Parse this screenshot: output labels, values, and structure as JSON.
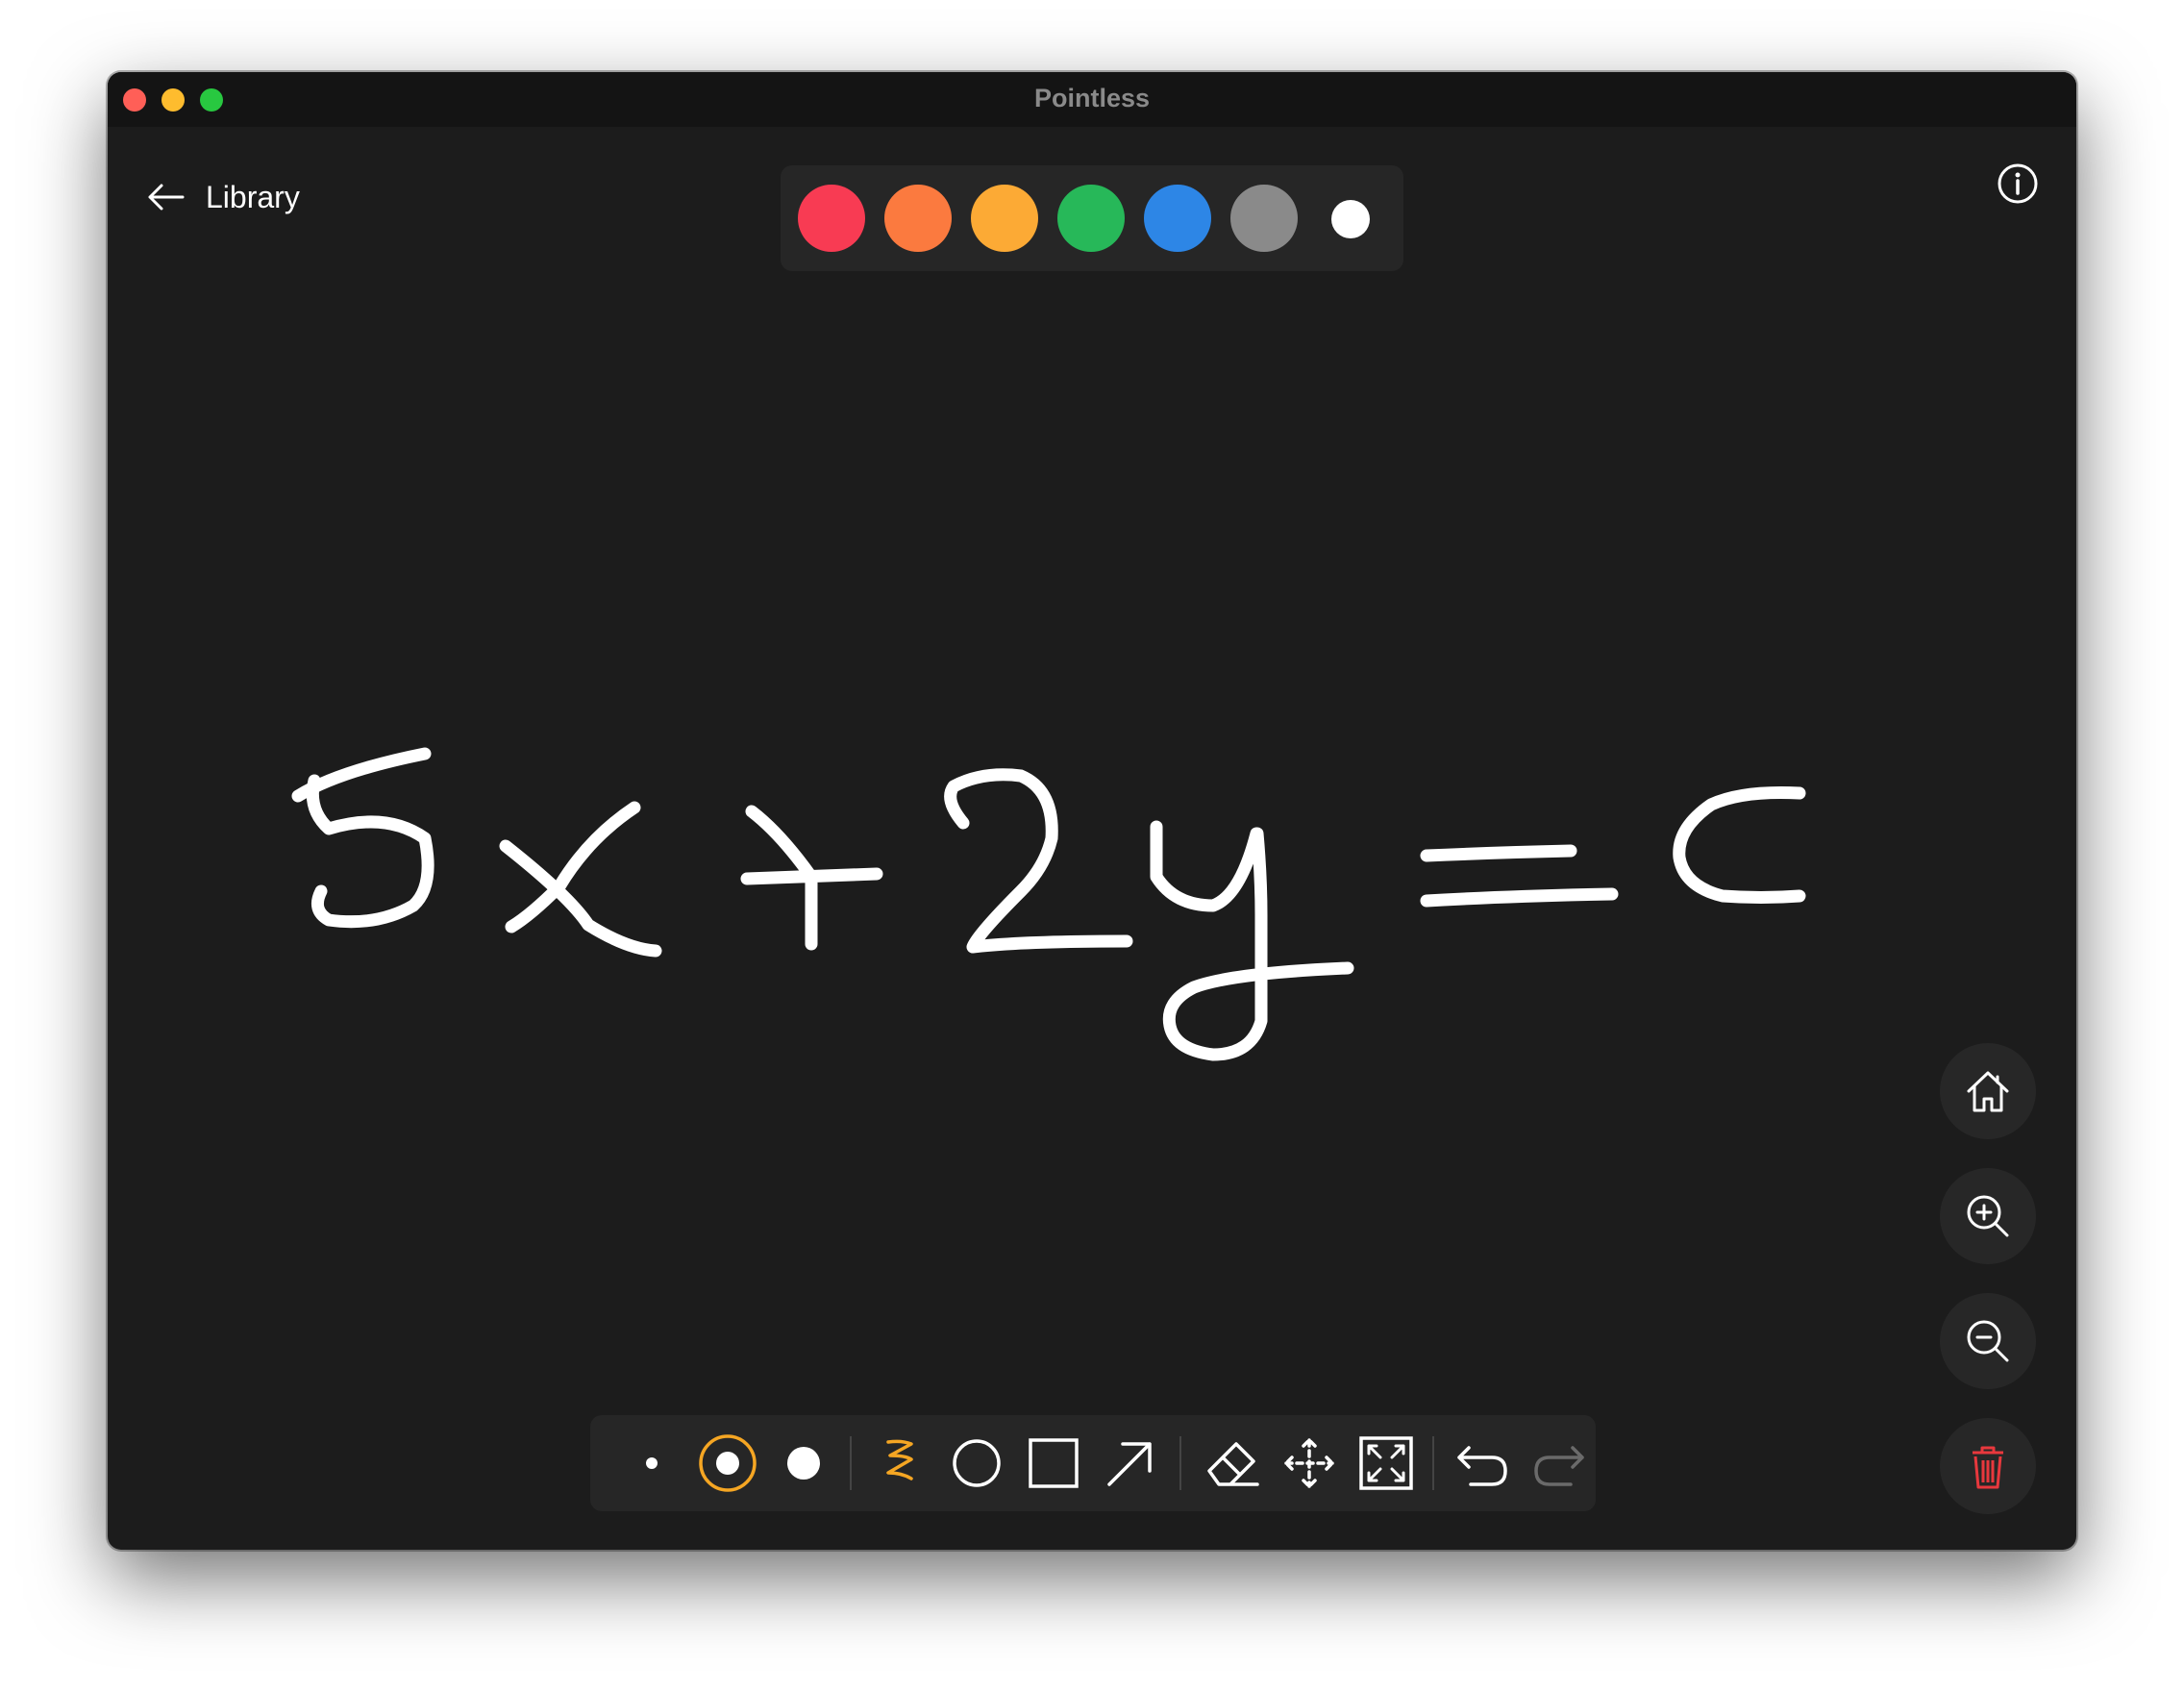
{
  "window": {
    "title": "Pointless"
  },
  "nav": {
    "back_label": "Library",
    "back_icon": "arrow-left-icon",
    "info_icon": "info-icon"
  },
  "palette": {
    "colors": [
      "#f83b53",
      "#fb7a3f",
      "#fcaa35",
      "#27b859",
      "#2d86e6",
      "#8a8a8a",
      "#ffffff"
    ],
    "selected": "#ffffff"
  },
  "canvas": {
    "stroke_color": "#ffffff",
    "background": "#1c1c1c"
  },
  "side_controls": [
    "home-icon",
    "zoom-in-icon",
    "zoom-out-icon",
    "trash-icon"
  ],
  "toolbar": {
    "sizes": [
      "small",
      "medium",
      "large"
    ],
    "selected_size": "medium",
    "tools": [
      "pen",
      "circle",
      "rectangle",
      "arrow"
    ],
    "selected_tool": "pen",
    "actions": [
      "eraser",
      "move",
      "fit-to-screen",
      "undo",
      "redo"
    ],
    "accent_color": "#f5a623",
    "delete_color": "#e8383d"
  }
}
